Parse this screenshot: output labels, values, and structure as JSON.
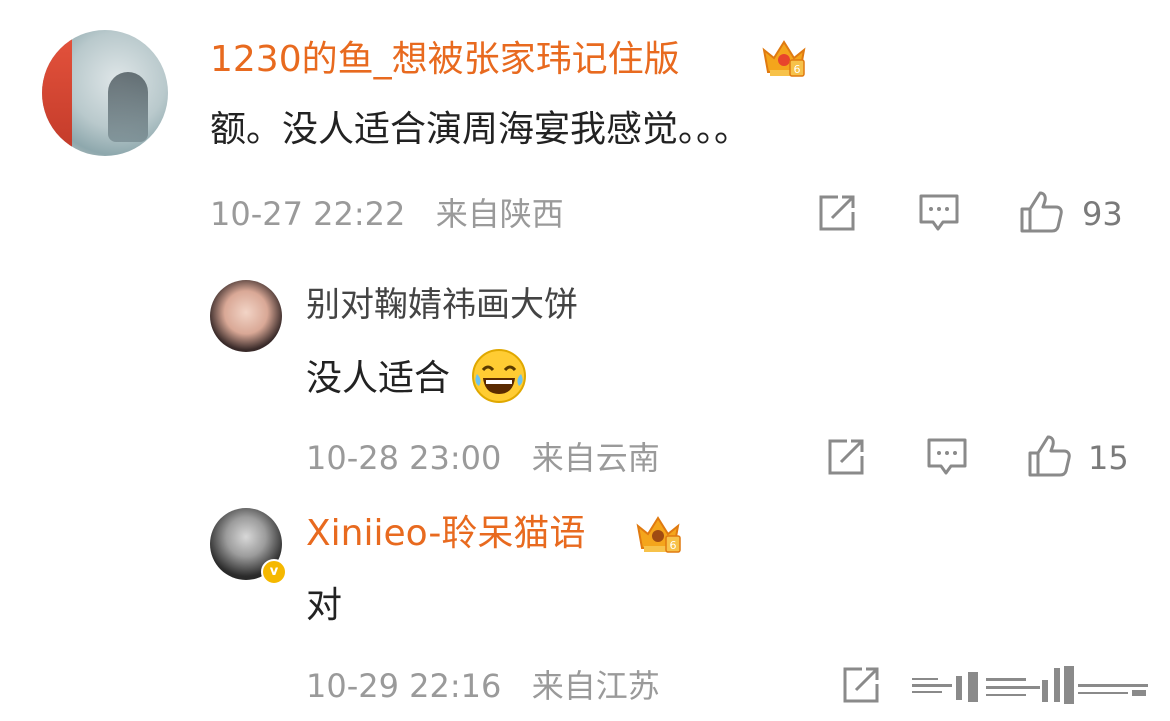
{
  "colors": {
    "accent": "#e86a1f",
    "text": "#222222",
    "meta": "#9a9a9a",
    "icon": "#8a8a8a",
    "badge_gold": "#f5b800"
  },
  "comments": [
    {
      "username": "1230的鱼_想被张家玮记住版",
      "content": "额。没人适合演周海宴我感觉。。。",
      "time": "10-27 22:22",
      "location": "来自陕西",
      "likes": "93",
      "badge_icon": "crown-badge-icon",
      "badge_level": "6",
      "replies": [
        {
          "username": "别对鞠婧祎画大饼",
          "content": "没人适合",
          "emoji": "😂",
          "time": "10-28 23:00",
          "location": "来自云南",
          "likes": "15"
        },
        {
          "username": "Xiniieo-聆呆猫语",
          "content": "对",
          "time": "10-29 22:16",
          "location": "来自江苏",
          "verified_badge": "v",
          "badge_icon": "crown-badge-icon",
          "badge_level": "6"
        }
      ]
    }
  ],
  "icons": {
    "share": "share-icon",
    "comment": "comment-icon",
    "like": "like-icon"
  }
}
